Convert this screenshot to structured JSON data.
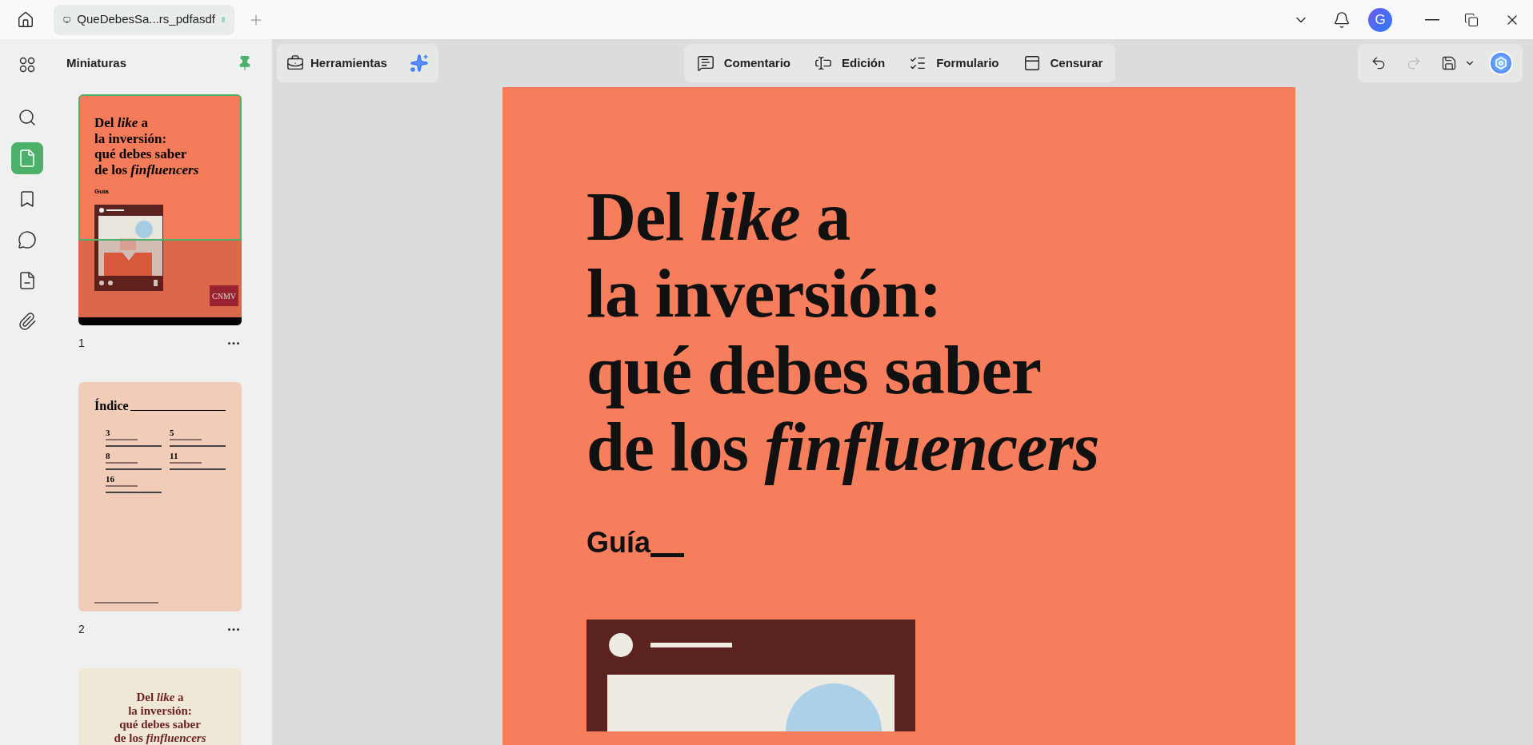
{
  "tab": {
    "label": "QueDebesSa...rs_pdfasdf",
    "selected": true,
    "modified": true
  },
  "account": {
    "initial": "G"
  },
  "rail": [
    {
      "kind": "apps",
      "selected": false
    },
    {
      "kind": "search",
      "selected": false
    },
    {
      "kind": "pages",
      "selected": true
    },
    {
      "kind": "bookmarks",
      "selected": false
    },
    {
      "kind": "comments",
      "selected": false
    },
    {
      "kind": "files",
      "selected": false
    },
    {
      "kind": "attachments",
      "selected": false
    }
  ],
  "panel": {
    "title": "Miniaturas",
    "pinned": true
  },
  "thumbnails": [
    {
      "kind": "cover",
      "number": "1",
      "selected": true,
      "title_lines": [
        "Del *like* a",
        "la inversión:",
        "qué debes saber",
        "de los *finfluencers*"
      ],
      "subtitle": "Guía",
      "logo": "CNMV"
    },
    {
      "kind": "index",
      "number": "2",
      "selected": false,
      "heading": "Índice",
      "entries": [
        "3",
        "5",
        "8",
        "11",
        "16"
      ]
    },
    {
      "kind": "cover-light",
      "selected": false,
      "title_lines": [
        "Del *like* a",
        "la inversión:",
        "qué debes saber",
        "de los *finfluencers*"
      ]
    }
  ],
  "tools": {
    "label": "Herramientas"
  },
  "modes": [
    {
      "kind": "comment",
      "label": "Comentario"
    },
    {
      "kind": "edit",
      "label": "Edición"
    },
    {
      "kind": "form",
      "label": "Formulario"
    },
    {
      "kind": "redact",
      "label": "Censurar"
    }
  ],
  "actions": [
    {
      "kind": "undo",
      "disabled": false
    },
    {
      "kind": "redo",
      "disabled": true
    },
    {
      "kind": "save",
      "disabled": false
    }
  ],
  "document": {
    "title_lines": [
      "Del *like* a",
      "la inversión:",
      "qué debes saber",
      "de los *finfluencers*"
    ],
    "subtitle": "Guía"
  }
}
